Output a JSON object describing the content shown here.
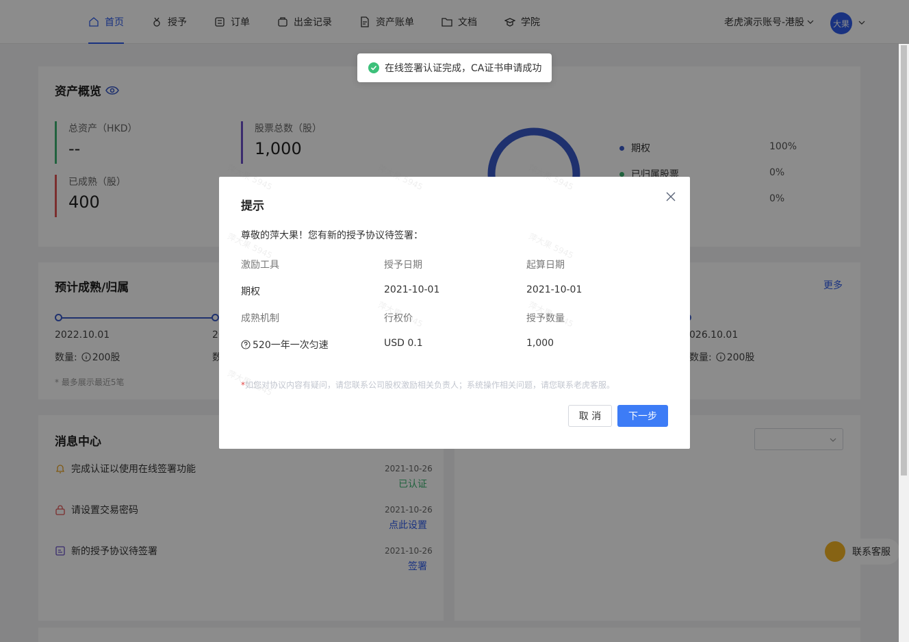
{
  "nav": {
    "items": [
      {
        "label": "首页",
        "icon": "home-icon",
        "active": true
      },
      {
        "label": "授予",
        "icon": "medal-icon",
        "active": false
      },
      {
        "label": "订单",
        "icon": "order-icon",
        "active": false
      },
      {
        "label": "出金记录",
        "icon": "wallet-icon",
        "active": false
      },
      {
        "label": "资产账单",
        "icon": "document-icon",
        "active": false
      },
      {
        "label": "文档",
        "icon": "folder-icon",
        "active": false
      },
      {
        "label": "学院",
        "icon": "academy-icon",
        "active": false
      }
    ],
    "account": "老虎演示账号-港股",
    "avatar": "大果"
  },
  "assets": {
    "title": "资产概览",
    "total_label": "总资产（HKD）",
    "total_value": "--",
    "shares_label": "股票总数（股）",
    "shares_value": "1,000",
    "vested_label": "已成熟（股）",
    "vested_value": "400",
    "legend": [
      {
        "label": "期权",
        "pct": "100%",
        "color": "#3a5ac8"
      },
      {
        "label": "已归属股票",
        "pct": "0%",
        "color": "#3cb371"
      },
      {
        "label": "",
        "pct": "0%",
        "color": "#ffffff"
      }
    ]
  },
  "vesting": {
    "title": "预计成熟/归属",
    "more": "更多",
    "first_date": "2022.10.01",
    "second_date_partial": "20",
    "last_date_partial": "026.10.01",
    "qty_label": "数量:",
    "first_qty": "200股",
    "last_qty": "200股",
    "qty_label_partial": "数",
    "note": "* 最多展示最近5笔"
  },
  "messages": {
    "title": "消息中心",
    "items": [
      {
        "text": "完成认证以使用在线签署功能",
        "date": "2021-10-26",
        "action": "已认证",
        "action_color": "#3cb371",
        "icon": "bell-icon"
      },
      {
        "text": "请设置交易密码",
        "date": "2021-10-26",
        "action": "点此设置",
        "action_color": "#2f5bea",
        "icon": "lock-icon"
      },
      {
        "text": "新的授予协议待签署",
        "date": "2021-10-26",
        "action": "签署",
        "action_color": "#2f5bea",
        "icon": "sign-icon"
      }
    ]
  },
  "toast": {
    "text": "在线签署认证完成，CA证书申请成功"
  },
  "modal": {
    "title": "提示",
    "intro": "尊敬的萍大果！您有新的授予协议待签署：",
    "row1_headers": [
      "激励工具",
      "授予日期",
      "起算日期"
    ],
    "row1_values": [
      "期权",
      "2021-10-01",
      "2021-10-01"
    ],
    "row2_headers": [
      "成熟机制",
      "行权价",
      "授予数量"
    ],
    "row2_values": [
      "520一年一次匀速",
      "USD 0.1",
      "1,000"
    ],
    "note_star": "*",
    "note": "如您对协议内容有疑问，请您联系公司股权激励相关负责人；系统操作相关问题，请您联系老虎客服。",
    "cancel": "取 消",
    "next": "下一步"
  },
  "support": {
    "label": "联系客服"
  },
  "watermark": "萍大果 5945"
}
